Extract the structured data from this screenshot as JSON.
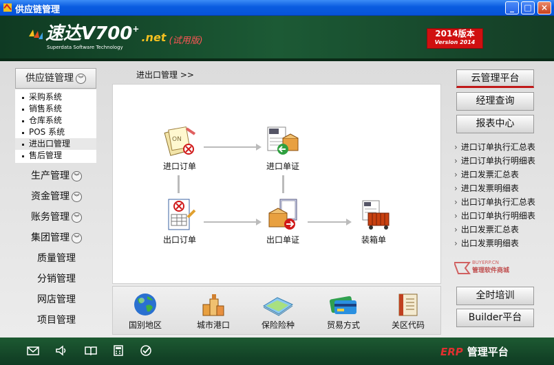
{
  "window": {
    "title": "供应链管理",
    "minimize": "_",
    "maximize": "□",
    "close": "×"
  },
  "header": {
    "logo_name": "速达V700",
    "logo_plus": "+",
    "logo_net": ".net",
    "logo_trial": "(试用版)",
    "logo_sub": "Superdata Software Technology",
    "version_cn": "2014版本",
    "version_en": "Version 2014"
  },
  "sidebar": {
    "module": "供应链管理",
    "sub_items": [
      {
        "label": "采购系统"
      },
      {
        "label": "销售系统"
      },
      {
        "label": "仓库系统"
      },
      {
        "label": "POS 系统"
      },
      {
        "label": "进出口管理"
      },
      {
        "label": "售后管理"
      }
    ],
    "items": [
      {
        "label": "生产管理",
        "expand": true
      },
      {
        "label": "资金管理",
        "expand": true
      },
      {
        "label": "账务管理",
        "expand": true
      },
      {
        "label": "集团管理",
        "expand": true
      },
      {
        "label": "质量管理",
        "expand": false
      },
      {
        "label": "分销管理",
        "expand": false
      },
      {
        "label": "网店管理",
        "expand": false
      },
      {
        "label": "项目管理",
        "expand": false
      }
    ]
  },
  "breadcrumb": "进出口管理  >>",
  "flow": {
    "import_order": "进口订单",
    "import_doc": "进口单证",
    "export_order": "出口订单",
    "export_doc": "出口单证",
    "packing": "装箱单"
  },
  "bottom": {
    "country": "国别地区",
    "port": "城市港口",
    "insurance": "保险险种",
    "trade": "贸易方式",
    "customs": "关区代码"
  },
  "right": {
    "cloud": "云管理平台",
    "manager": "经理查询",
    "report": "报表中心",
    "links": [
      "进口订单执行汇总表",
      "进口订单执行明细表",
      "进口发票汇总表",
      "进口发票明细表",
      "出口订单执行汇总表",
      "出口订单执行明细表",
      "出口发票汇总表",
      "出口发票明细表"
    ],
    "buyerp_top": "BUYERP.CN",
    "buyerp": "管理软件商城",
    "training": "全时培训",
    "builder": "Builder平台"
  },
  "footer": {
    "erp": "ERP",
    "platform": "管理平台"
  },
  "icons": [
    "mail-icon",
    "speaker-icon",
    "book-icon",
    "calculator-icon",
    "check-icon"
  ]
}
